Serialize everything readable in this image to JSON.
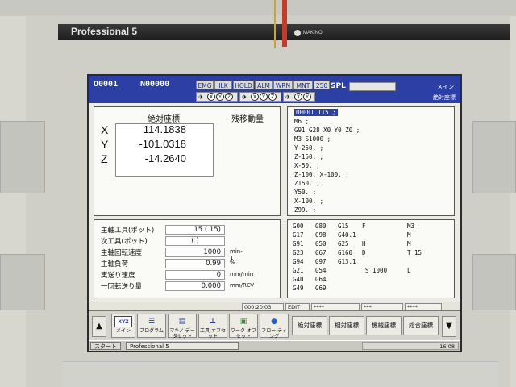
{
  "machine": {
    "model": "Professional 5",
    "brand_logo": "MAKINO"
  },
  "header": {
    "program_no": "O0001",
    "sequence_no": "N00000",
    "flags": [
      "EMG",
      "ILK",
      "HOLD",
      "ALM",
      "WRN",
      "MNT",
      "250"
    ],
    "spl_label": "SPL",
    "mode_label": "メイン",
    "sub_label": "絶対座標",
    "axes_set1": [
      "X",
      "Y",
      "Z"
    ],
    "axes_set2": [
      "X",
      "Y",
      "Z"
    ],
    "axes_set3": [
      "X",
      "Y"
    ]
  },
  "position": {
    "absolute_title": "絶対座標",
    "remaining_title": "残移動量",
    "axes": [
      {
        "name": "X",
        "value": "114.1838"
      },
      {
        "name": "Y",
        "value": "-101.0318"
      },
      {
        "name": "Z",
        "value": "-14.2640"
      }
    ]
  },
  "program": {
    "selected": "O0001 T15 ;",
    "lines": [
      "M6 ;",
      "G91 G28 X0 Y0 Z0 ;",
      "M3 S1000 ;",
      "Y-250. ;",
      "Z-150. ;",
      "X-50. ;",
      "Z-100. X-100. ;",
      "Z150. ;",
      "Y50. ;",
      "X-100. ;",
      "Z99. ;"
    ]
  },
  "spindle": {
    "rows": [
      {
        "label": "主軸工具(ポット)",
        "value": "15 ( 15)",
        "unit": ""
      },
      {
        "label": "次工具(ポット)",
        "value": "(   )",
        "unit": ""
      },
      {
        "label": "主軸回転速度",
        "value": "1000",
        "unit": "min-1"
      },
      {
        "label": "主軸負荷",
        "value": "0.99",
        "unit": "%"
      },
      {
        "label": "実送り速度",
        "value": "0",
        "unit": "mm/min"
      },
      {
        "label": "一回転送り量",
        "value": "0.000",
        "unit": "mm/REV"
      }
    ]
  },
  "modal": {
    "rows": [
      [
        "G00",
        "G80",
        "G15",
        "F",
        "M3"
      ],
      [
        "G17",
        "G98",
        "G40.1",
        "",
        "M"
      ],
      [
        "G91",
        "G50",
        "G25",
        "H",
        "M"
      ],
      [
        "G23",
        "G67",
        "G160",
        "D",
        "T 15"
      ],
      [
        "G94",
        "G97",
        "G13.1",
        "",
        ""
      ],
      [
        "G21",
        "G54",
        "",
        "S 1000",
        "L"
      ],
      [
        "G40",
        "G64",
        "",
        "",
        ""
      ],
      [
        "G49",
        "G69",
        "",
        "",
        ""
      ]
    ]
  },
  "status": {
    "time": "000:20:03",
    "mode": "EDIT",
    "s1": "****",
    "s2": "***",
    "s3": "****"
  },
  "fkeys": {
    "menu": "メイン",
    "program": "プログラム",
    "machine_data": "マキノ データセット",
    "tool_offset": "工具 オフセット",
    "work_offset": "ワーク オフセット",
    "flow": "フロー ティング",
    "abs_pos": "絶対座標",
    "rel_pos": "相対座標",
    "mach_pos": "機械座標",
    "total_pos": "総合座標",
    "xyz_icon": "XYZ"
  },
  "taskbar": {
    "start": "スタート",
    "task": "Professional 5",
    "time": "16:08"
  }
}
